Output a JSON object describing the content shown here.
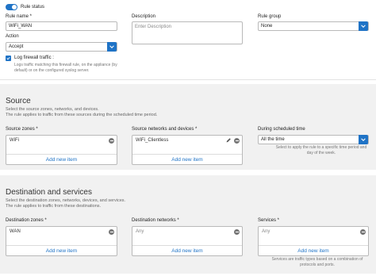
{
  "rule_status": {
    "label": "Rule status",
    "enabled": true
  },
  "rule_name": {
    "label": "Rule name *",
    "value": "WiFi_WAN"
  },
  "description": {
    "label": "Description",
    "placeholder": "Enter Description"
  },
  "rule_group": {
    "label": "Rule group",
    "value": "None"
  },
  "action": {
    "label": "Action",
    "value": "Accept"
  },
  "log_firewall": {
    "label": "Log firewall traffic :",
    "checked": true,
    "hint_line1": "Logs traffic matching this firewall rule, on the appliance (by",
    "hint_line2": "default) or on the configured syslog server."
  },
  "source": {
    "title": "Source",
    "desc1": "Select the source zones, networks, and devices.",
    "desc2": "The rule applies to traffic from these sources during the scheduled time period.",
    "zones": {
      "label": "Source zones *",
      "item": "WiFi",
      "add": "Add new item"
    },
    "networks": {
      "label": "Source networks and devices *",
      "item": "WiFi_Clientless",
      "add": "Add new item"
    },
    "schedule": {
      "label": "During scheduled time",
      "value": "All the time",
      "hint_line1": "Select to apply the rule to a specific time period and",
      "hint_line2": "day of the week."
    }
  },
  "destination": {
    "title": "Destination and services",
    "desc1": "Select the destination zones, networks, devices, and services.",
    "desc2": "The rule applies to traffic from these destinations.",
    "zones": {
      "label": "Destination zones *",
      "item": "WAN",
      "add": "Add new item"
    },
    "networks": {
      "label": "Destination networks *",
      "item": "Any",
      "add": "Add new item"
    },
    "services": {
      "label": "Services *",
      "item": "Any",
      "add": "Add new item",
      "hint_line1": "Services are traffic types based on a combination of",
      "hint_line2": "protocols and ports."
    }
  },
  "colors": {
    "accent": "#1f73c6",
    "section_bg": "#f1f1f1"
  },
  "icons": [
    "toggle-switch",
    "chevron-down-icon",
    "checkmark-icon",
    "minus-circle-icon",
    "pencil-icon"
  ]
}
